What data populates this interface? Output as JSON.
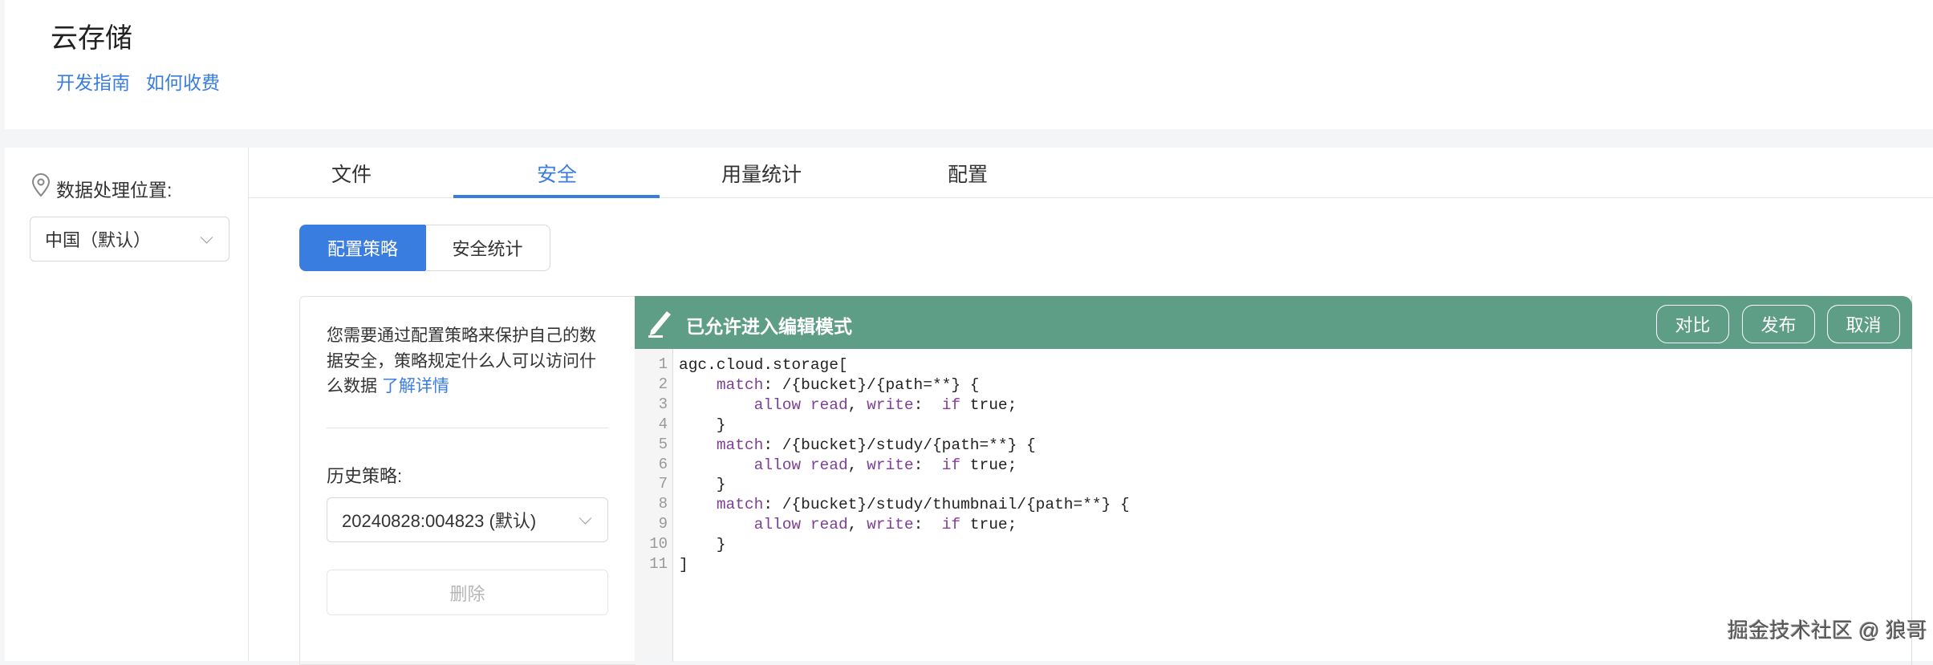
{
  "header": {
    "title": "云存储",
    "links": [
      "开发指南",
      "如何收费"
    ]
  },
  "sidebar": {
    "location_label": "数据处理位置:",
    "location_value": "中国（默认）"
  },
  "tabs": [
    {
      "label": "文件"
    },
    {
      "label": "安全",
      "active": true
    },
    {
      "label": "用量统计"
    },
    {
      "label": "配置"
    }
  ],
  "subtabs": [
    {
      "label": "配置策略",
      "active": true
    },
    {
      "label": "安全统计"
    }
  ],
  "policy_panel": {
    "desc": "您需要通过配置策略来保护自己的数据安全，策略规定什么人可以访问什么数据",
    "learn_more": "了解详情",
    "history_label": "历史策略:",
    "history_value": "20240828:004823 (默认)",
    "delete_label": "删除"
  },
  "editor": {
    "title": "已允许进入编辑模式",
    "buttons": [
      "对比",
      "发布",
      "取消"
    ],
    "accent": "#5e9e86",
    "lines": [
      "agc.cloud.storage[",
      "    match: /{bucket}/{path=**} {",
      "        allow read, write:  if true;",
      "    }",
      "    match: /{bucket}/study/{path=**} {",
      "        allow read, write:  if true;",
      "    }",
      "    match: /{bucket}/study/thumbnail/{path=**} {",
      "        allow read, write:  if true;",
      "    }",
      "]"
    ]
  },
  "watermark": "掘金技术社区 @ 狼哥"
}
